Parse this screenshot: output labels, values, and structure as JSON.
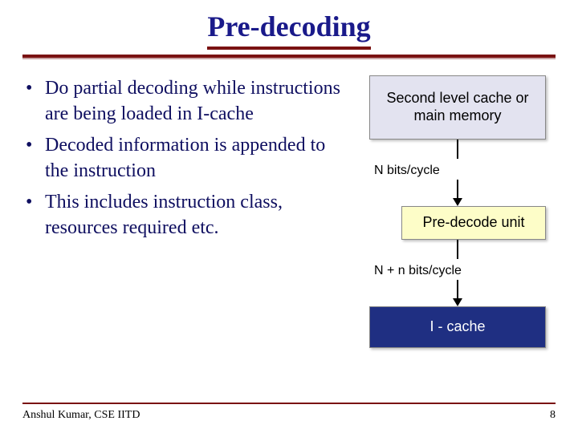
{
  "title": "Pre-decoding",
  "bullets": [
    "Do partial decoding while instructions are being loaded in I-cache",
    "Decoded information is appended to the instruction",
    "This includes instruction class, resources required etc."
  ],
  "diagram": {
    "box1": "Second level cache or main memory",
    "label1": "N bits/cycle",
    "box2": "Pre-decode unit",
    "label2": "N + n bits/cycle",
    "box3": "I - cache"
  },
  "footer": {
    "author": "Anshul Kumar, CSE IITD",
    "page": "8"
  }
}
